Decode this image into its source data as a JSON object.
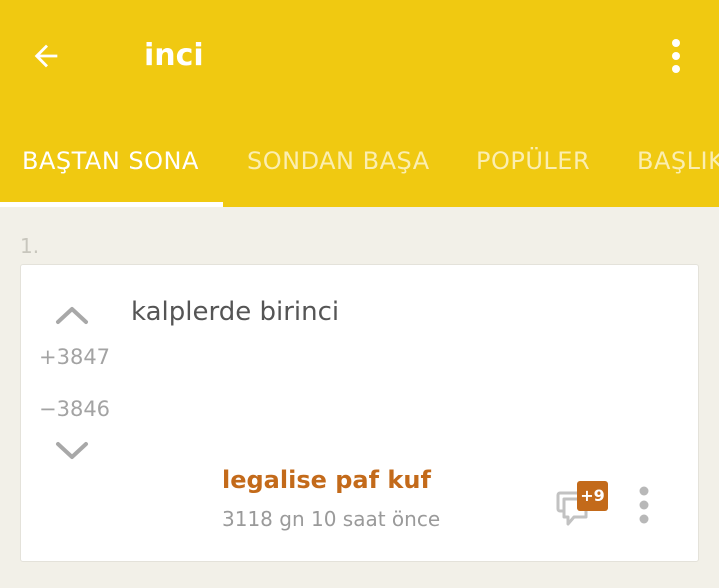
{
  "appbar": {
    "title": "inci",
    "back_icon": "arrow-left-icon",
    "menu_icon": "more-vertical-icon",
    "background": "#f0c911"
  },
  "tabs": [
    {
      "label": "BAŞTAN SONA",
      "active": true
    },
    {
      "label": "SONDAN BAŞA",
      "active": false
    },
    {
      "label": "POPÜLER",
      "active": false
    },
    {
      "label": "BAŞLIK",
      "active": false
    }
  ],
  "entry": {
    "index": "1.",
    "text": "kalplerde birinci",
    "upvotes": "+3847",
    "downvotes": "−3846",
    "author": "legalise paf kuf",
    "timestamp": "3118 gn 10 saat  önce",
    "comment_badge": "+9",
    "accent": "#c36a1a"
  }
}
